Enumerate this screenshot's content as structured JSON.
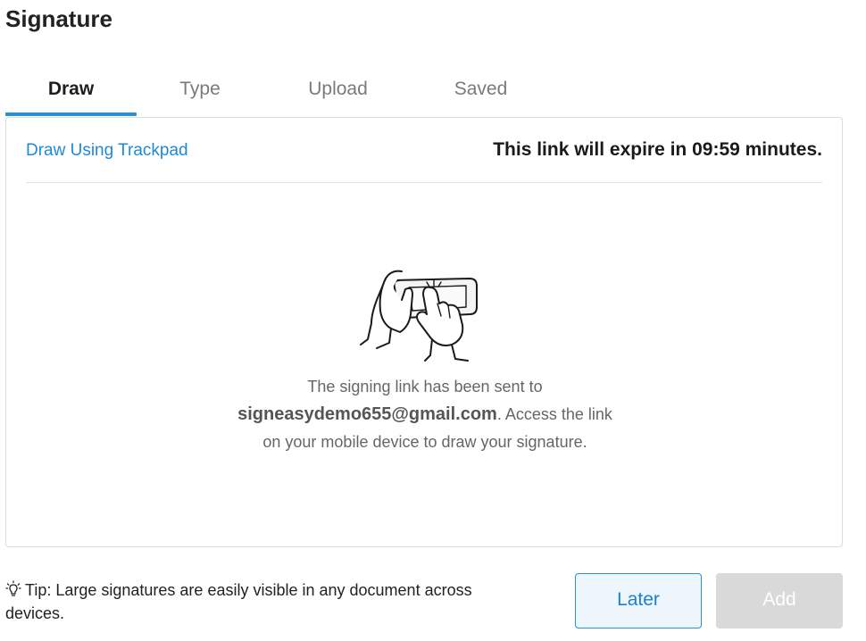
{
  "dialog": {
    "title": "Signature"
  },
  "tabs": [
    {
      "label": "Draw",
      "active": true
    },
    {
      "label": "Type",
      "active": false
    },
    {
      "label": "Upload",
      "active": false
    },
    {
      "label": "Saved",
      "active": false
    }
  ],
  "panel": {
    "trackpad_link": "Draw Using Trackpad",
    "expire_text": "This link will expire in 09:59 minutes.",
    "message_line1": "The signing link has been sent to",
    "email": "signeasydemo655@gmail.com",
    "message_after_email": ". Access the link",
    "message_line3": "on your mobile device to draw your signature.",
    "illustration_icon": "hands-holding-phone-icon"
  },
  "footer": {
    "tip_icon": "lightbulb-icon",
    "tip_text": "Tip: Large signatures are easily visible in any document across devices.",
    "later_label": "Later",
    "add_label": "Add"
  },
  "colors": {
    "accent": "#2a8fd4",
    "link": "#1e8ad6",
    "disabled_button": "#d9d9d9"
  }
}
